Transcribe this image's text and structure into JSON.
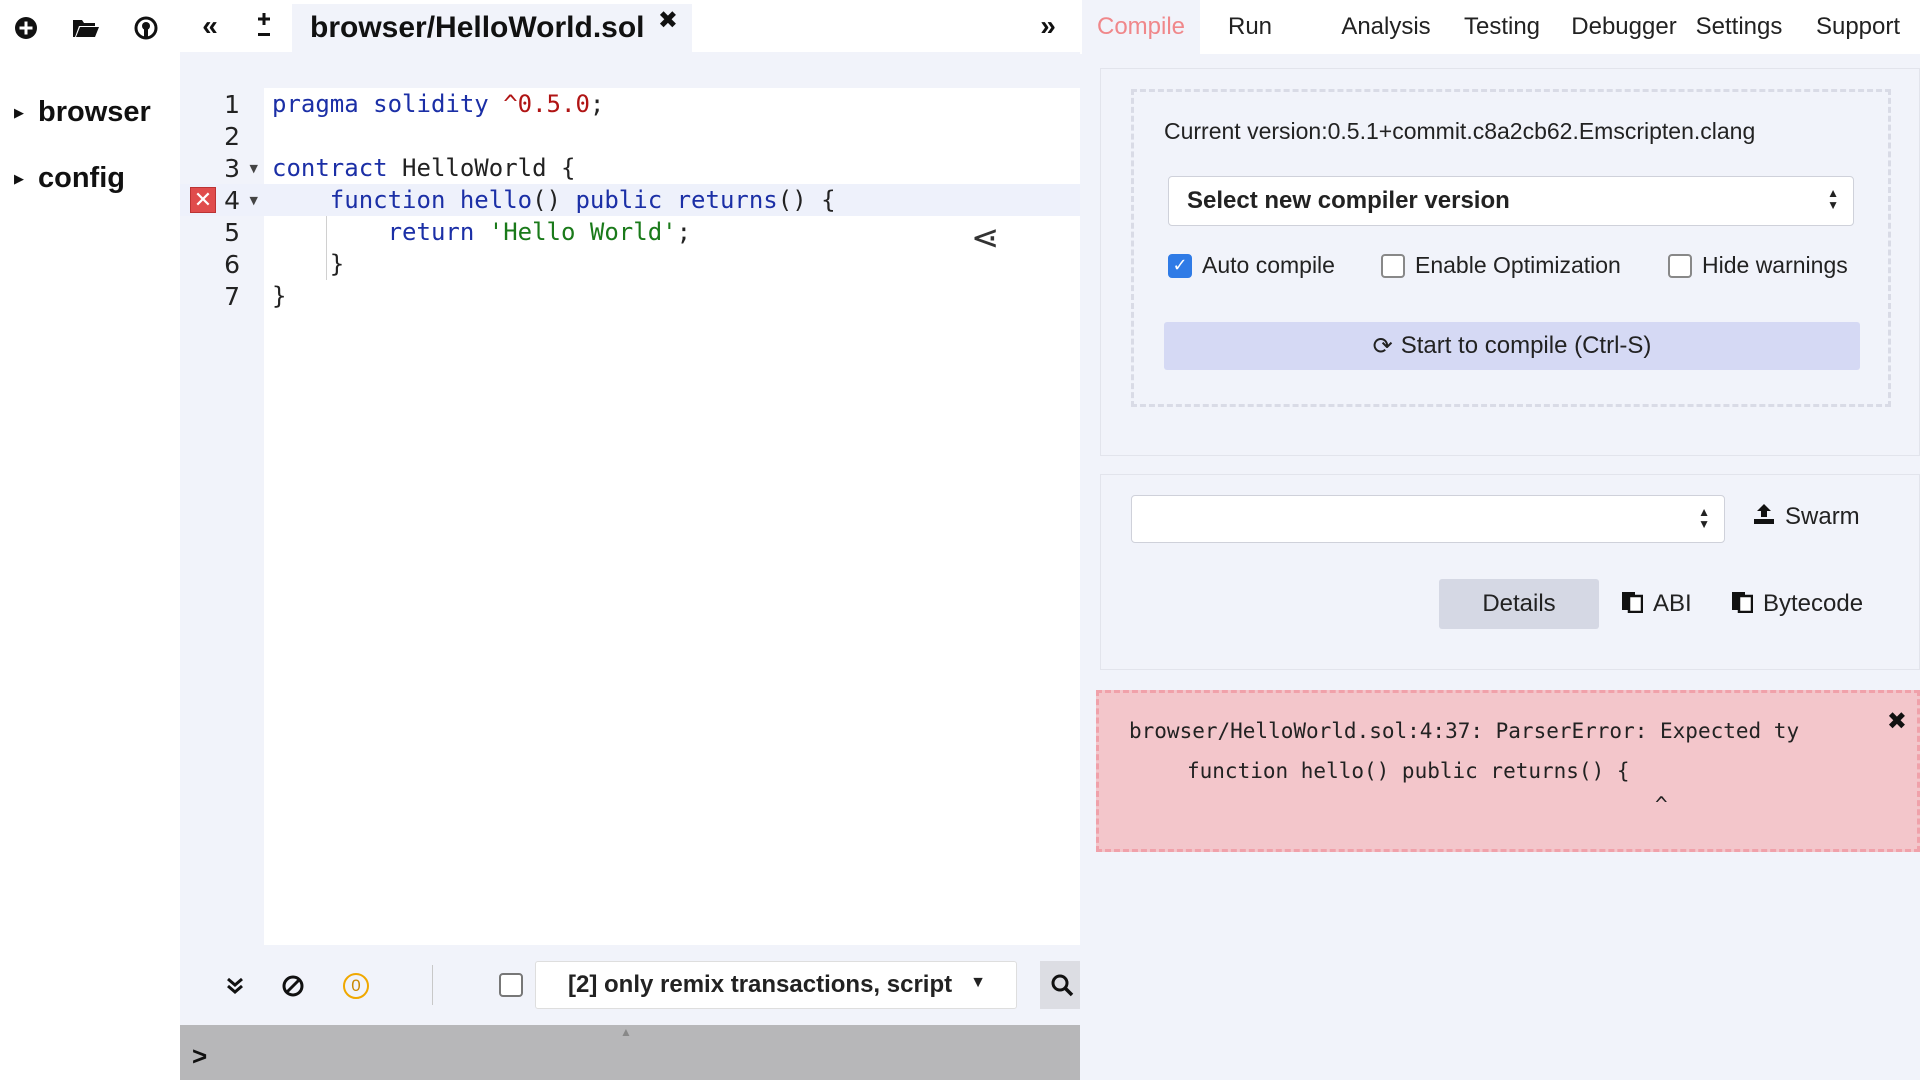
{
  "file_toolbar": {
    "icons": [
      "add-file-icon",
      "open-folder-icon",
      "github-icon"
    ]
  },
  "file_tree": {
    "items": [
      {
        "label": "browser"
      },
      {
        "label": "config"
      }
    ]
  },
  "editor": {
    "tab_label": "browser/HelloWorld.sol",
    "line_numbers": [
      "1",
      "2",
      "3",
      "4",
      "5",
      "6",
      "7"
    ],
    "code_lines": [
      "pragma solidity ^0.5.0;",
      "",
      "contract HelloWorld {",
      "    function hello() public returns() {",
      "        return 'Hello World';",
      "    }",
      "}"
    ],
    "error_line": "4",
    "active_line": "4"
  },
  "terminal": {
    "pending_count": "0",
    "filter_label": "[2] only remix transactions, script",
    "prompt": ">"
  },
  "right_panel": {
    "tabs": [
      "Compile",
      "Run",
      "Analysis",
      "Testing",
      "Debugger",
      "Settings",
      "Support"
    ],
    "active_tab": "Compile",
    "compiler": {
      "current_version": "Current version:0.5.1+commit.c8a2cb62.Emscripten.clang",
      "select_placeholder": "Select new compiler version",
      "options": [
        {
          "label": "Auto compile",
          "checked": true
        },
        {
          "label": "Enable Optimization",
          "checked": false
        },
        {
          "label": "Hide warnings",
          "checked": false
        }
      ],
      "compile_button": "Start to compile (Ctrl-S)"
    },
    "contract": {
      "selected": "",
      "swarm_label": "Swarm",
      "details_label": "Details",
      "abi_label": "ABI",
      "bytecode_label": "Bytecode"
    },
    "error": {
      "line1": "browser/HelloWorld.sol:4:37: ParserError: Expected ty",
      "line2": "function hello() public returns() {",
      "line3": "^"
    }
  },
  "colors": {
    "accent_tab": "#f0878a",
    "error_bg": "#f3c6cb",
    "checkbox_checked": "#2f7be6",
    "keyword": "#1b2fa6",
    "string": "#1a7a1a",
    "number": "#b01414"
  }
}
